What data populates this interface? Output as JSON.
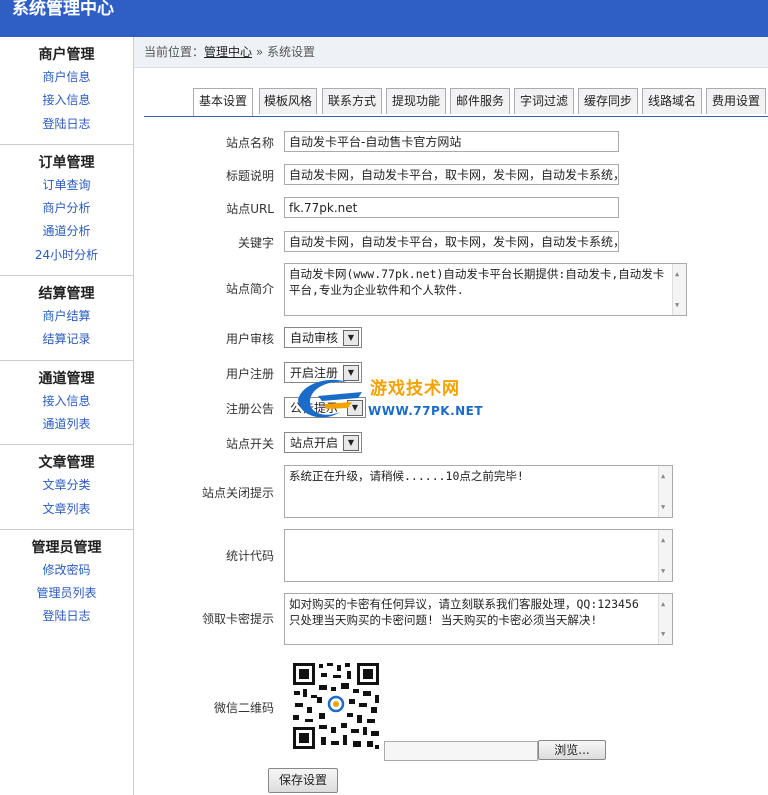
{
  "header": {
    "title": "系统管理中心"
  },
  "sidebar": [
    {
      "title": "商户管理",
      "items": [
        "商户信息",
        "接入信息",
        "登陆日志"
      ]
    },
    {
      "title": "订单管理",
      "items": [
        "订单查询",
        "商户分析",
        "通道分析",
        "24小时分析"
      ]
    },
    {
      "title": "结算管理",
      "items": [
        "商户结算",
        "结算记录"
      ]
    },
    {
      "title": "通道管理",
      "items": [
        "接入信息",
        "通道列表"
      ]
    },
    {
      "title": "文章管理",
      "items": [
        "文章分类",
        "文章列表"
      ]
    },
    {
      "title": "管理员管理",
      "items": [
        "修改密码",
        "管理员列表",
        "登陆日志"
      ]
    }
  ],
  "breadcrumb": {
    "prefix": "当前位置：",
    "link": "管理中心",
    "sep": " » ",
    "current": "系统设置"
  },
  "tabs": [
    "基本设置",
    "模板风格",
    "联系方式",
    "提现功能",
    "邮件服务",
    "字词过滤",
    "缓存同步",
    "线路域名",
    "费用设置"
  ],
  "form": {
    "site_name": {
      "label": "站点名称",
      "value": "自动发卡平台-自动售卡官方网站"
    },
    "title_desc": {
      "label": "标题说明",
      "value": "自动发卡网，自动发卡平台，取卡网，发卡网，自动发卡系统，"
    },
    "site_url": {
      "label": "站点URL",
      "value": "fk.77pk.net"
    },
    "keywords": {
      "label": "关键字",
      "value": "自动发卡网，自动发卡平台，取卡网，发卡网，自动发卡系统，"
    },
    "intro": {
      "label": "站点简介",
      "value": "自动发卡网(www.77pk.net)自动发卡平台长期提供:自动发卡,自动发卡平台,专业为企业软件和个人软件."
    },
    "user_audit": {
      "label": "用户审核",
      "value": "自动审核"
    },
    "user_register": {
      "label": "用户注册",
      "value": "开启注册"
    },
    "register_notice": {
      "label": "注册公告",
      "value": "公告提示"
    },
    "site_switch": {
      "label": "站点开关",
      "value": "站点开启"
    },
    "close_tip": {
      "label": "站点关闭提示",
      "value": "系统正在升级，请稍候......10点之前完毕!"
    },
    "stat_code": {
      "label": "统计代码",
      "value": ""
    },
    "card_tip": {
      "label": "领取卡密提示",
      "value": "如对购买的卡密有任何异议，请立刻联系我们客服处理，QQ:123456 只处理当天购买的卡密问题! 当天购买的卡密必须当天解决!"
    },
    "wechat_qr": {
      "label": "微信二维码"
    },
    "browse_label": "浏览...",
    "save_label": "保存设置"
  },
  "watermark": {
    "cn": "游戏技术网",
    "en": "WWW.77PK.NET"
  }
}
